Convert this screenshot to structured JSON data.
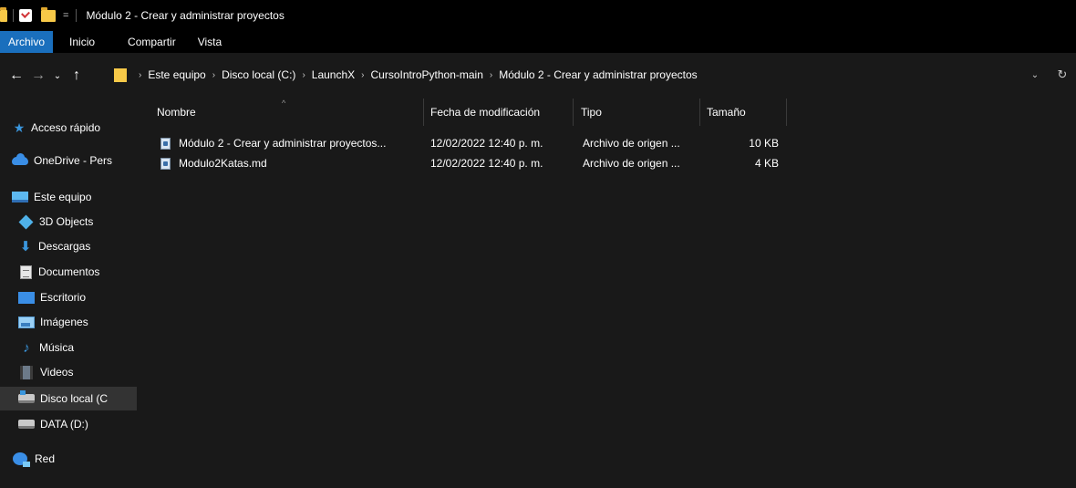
{
  "window": {
    "title": "Módulo 2 - Crear y administrar proyectos",
    "qa_dropdown": "="
  },
  "ribbon": {
    "tabs": [
      "Archivo",
      "Inicio",
      "Compartir",
      "Vista"
    ]
  },
  "nav": {
    "back": "←",
    "forward": "→",
    "recent": "⌄",
    "up": "↑",
    "breadcrumb": [
      "Este equipo",
      "Disco local (C:)",
      "LaunchX",
      "CursoIntroPython-main",
      "Módulo 2 - Crear y administrar proyectos"
    ],
    "separator": "›",
    "history_dropdown": "⌄",
    "refresh": "↻"
  },
  "sidebar": {
    "items": [
      {
        "label": "Acceso rápido",
        "icon": "star-icon"
      },
      {
        "label": "OneDrive - Pers",
        "icon": "cloud-icon"
      },
      {
        "label": "Este equipo",
        "icon": "computer-icon"
      },
      {
        "label": "3D Objects",
        "icon": "cube-icon"
      },
      {
        "label": "Descargas",
        "icon": "download-icon"
      },
      {
        "label": "Documentos",
        "icon": "document-icon"
      },
      {
        "label": "Escritorio",
        "icon": "desktop-icon"
      },
      {
        "label": "Imágenes",
        "icon": "pictures-icon"
      },
      {
        "label": "Música",
        "icon": "music-icon"
      },
      {
        "label": "Videos",
        "icon": "video-icon"
      },
      {
        "label": "Disco local (C",
        "icon": "drive-icon"
      },
      {
        "label": "DATA (D:)",
        "icon": "drive-icon"
      },
      {
        "label": "Red",
        "icon": "network-icon"
      }
    ]
  },
  "files": {
    "sort_indicator": "^",
    "columns": [
      "Nombre",
      "Fecha de modificación",
      "Tipo",
      "Tamaño"
    ],
    "rows": [
      {
        "name": "Módulo 2 - Crear y administrar proyectos...",
        "modified": "12/02/2022 12:40 p. m.",
        "type": "Archivo de origen ...",
        "size": "10 KB"
      },
      {
        "name": "Modulo2Katas.md",
        "modified": "12/02/2022 12:40 p. m.",
        "type": "Archivo de origen ...",
        "size": "4 KB"
      }
    ]
  },
  "colors": {
    "background": "#191919",
    "titlebar": "#000000",
    "accent": "#1a6fbd",
    "selected": "#333333"
  }
}
